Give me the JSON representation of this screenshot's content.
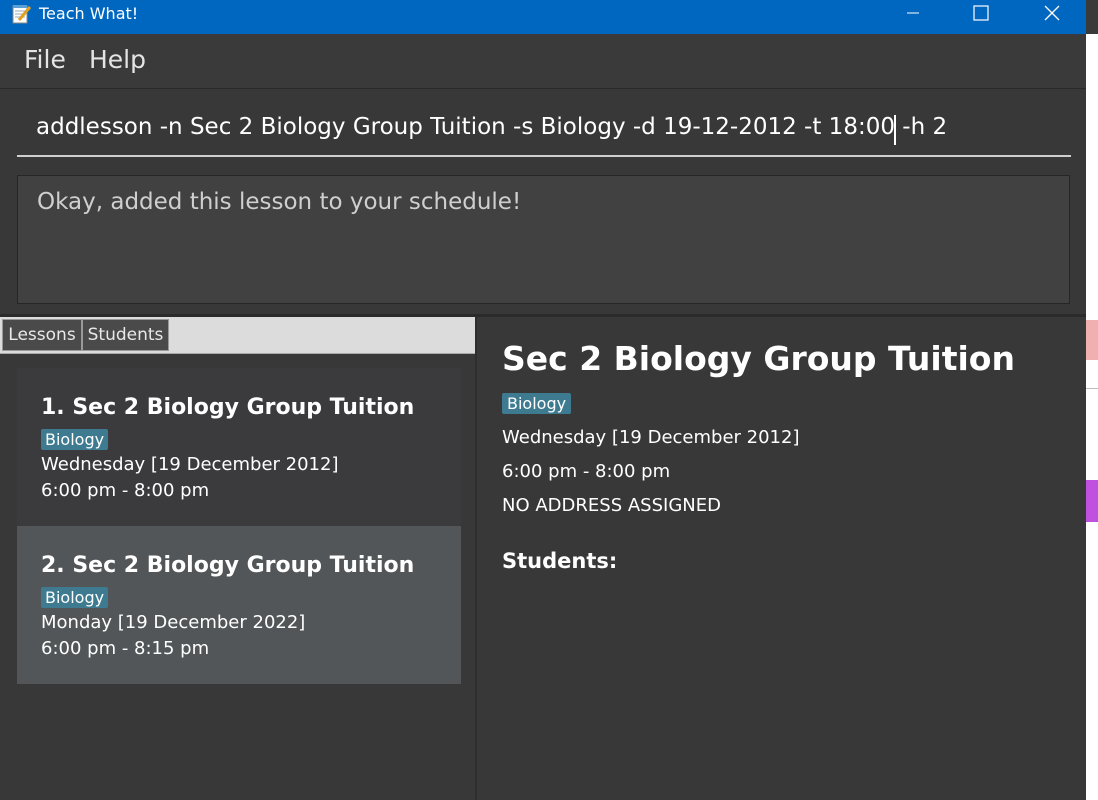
{
  "window": {
    "title": "Teach What!"
  },
  "menu": {
    "file": "File",
    "help": "Help"
  },
  "command": {
    "value": "addlesson -n Sec 2 Biology Group Tuition -s Biology -d 19-12-2012 -t 18:00 -h 2"
  },
  "result": {
    "message": "Okay, added this lesson to your schedule!"
  },
  "tabs": [
    {
      "label": "Lessons"
    },
    {
      "label": "Students"
    }
  ],
  "lessons": [
    {
      "title": "1.  Sec 2 Biology Group Tuition",
      "subject": "Biology",
      "date": "Wednesday [19 December 2012]",
      "time": "6:00 pm - 8:00 pm"
    },
    {
      "title": "2.  Sec 2 Biology Group Tuition",
      "subject": "Biology",
      "date": "Monday [19 December 2022]",
      "time": "6:00 pm - 8:15 pm"
    }
  ],
  "detail": {
    "title": "Sec 2 Biology Group Tuition",
    "subject": "Biology",
    "date": "Wednesday [19 December 2012]",
    "time": "6:00 pm - 8:00 pm",
    "address": "NO ADDRESS ASSIGNED",
    "students_label": "Students:"
  },
  "colors": {
    "titlebar": "#0067c0",
    "background": "#383838",
    "tag": "#3e7b91",
    "selected_card": "#525658",
    "card": "#3b3b3e"
  }
}
